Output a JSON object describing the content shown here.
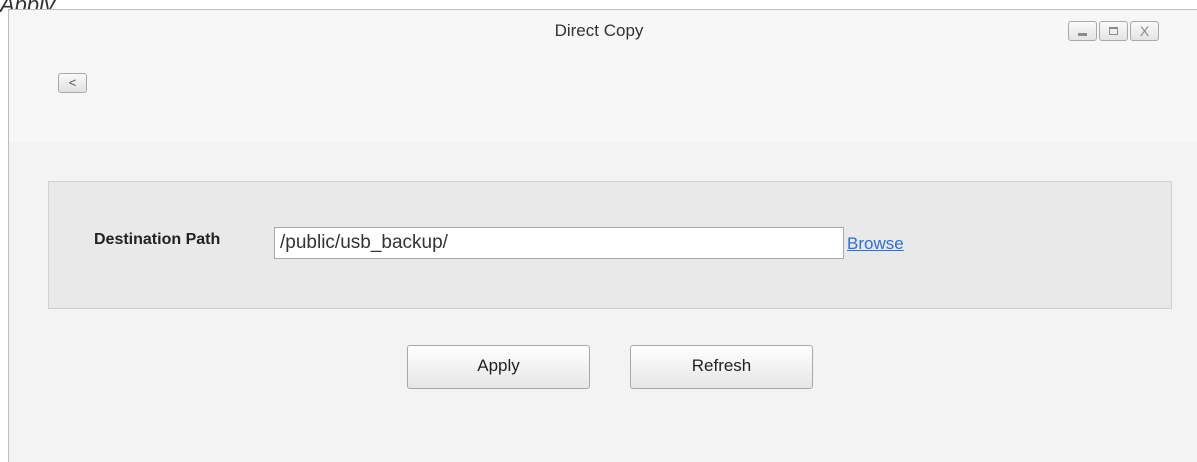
{
  "top_fragment": "Apply",
  "window": {
    "title": "Direct Copy",
    "controls": {
      "minimize_icon": "minimize-icon",
      "maximize_icon": "maximize-icon",
      "close_label": "X"
    }
  },
  "toolbar": {
    "back_label": "<"
  },
  "form": {
    "destination_label": "Destination Path",
    "destination_value": "/public/usb_backup/",
    "browse_label": "Browse"
  },
  "actions": {
    "apply_label": "Apply",
    "refresh_label": "Refresh"
  },
  "colors": {
    "link": "#2a6fdb",
    "panel_bg": "#e9e9e9",
    "window_bg": "#f7f7f7"
  }
}
